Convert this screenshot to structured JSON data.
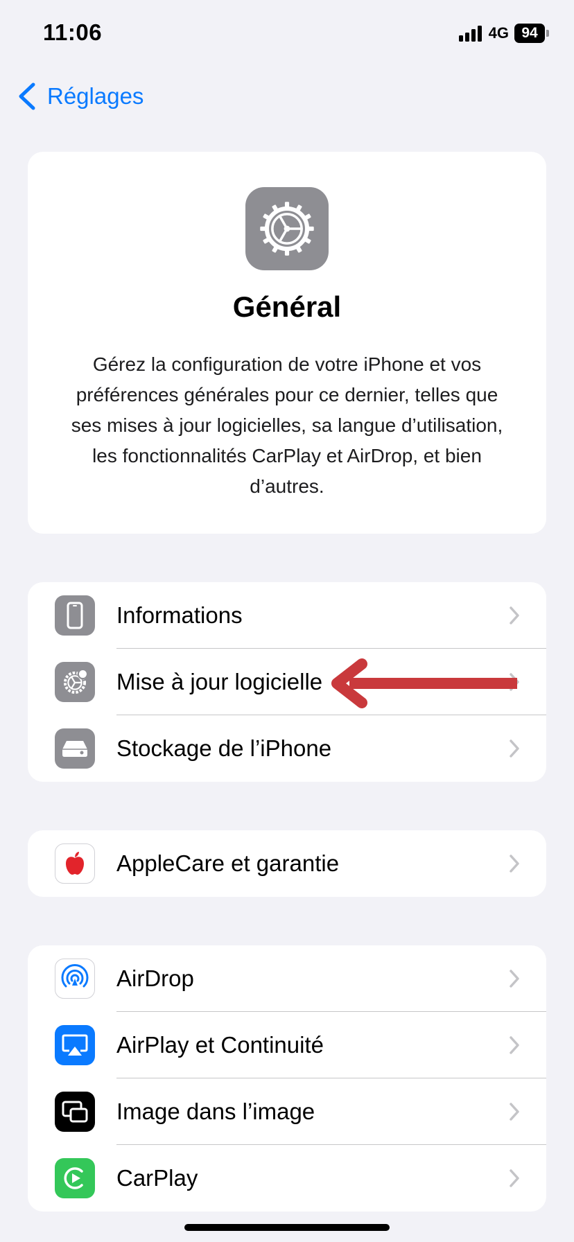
{
  "status_bar": {
    "time": "11:06",
    "network": "4G",
    "battery": "94"
  },
  "nav": {
    "back_label": "Réglages"
  },
  "hero": {
    "icon": "gear-icon",
    "title": "Général",
    "description": "Gérez la configuration de votre iPhone et vos préférences générales pour ce dernier, telles que ses mises à jour logicielles, sa langue d’utilisation, les fonctionnalités CarPlay et AirDrop, et bien d’autres."
  },
  "groups": [
    {
      "items": [
        {
          "label": "Informations",
          "icon": "phone-icon",
          "icon_color": "#8e8e93"
        },
        {
          "label": "Mise à jour logicielle",
          "icon": "gear-badge-icon",
          "icon_color": "#8e8e93"
        },
        {
          "label": "Stockage de l’iPhone",
          "icon": "storage-icon",
          "icon_color": "#8e8e93"
        }
      ]
    },
    {
      "items": [
        {
          "label": "AppleCare et garantie",
          "icon": "apple-icon",
          "icon_color": "#e2242b"
        }
      ]
    },
    {
      "items": [
        {
          "label": "AirDrop",
          "icon": "airdrop-icon",
          "icon_color": "#0a7aff"
        },
        {
          "label": "AirPlay et Continuité",
          "icon": "airplay-icon",
          "icon_color": "#0a7aff"
        },
        {
          "label": "Image dans l’image",
          "icon": "picture-in-picture-icon",
          "icon_color": "#000000"
        },
        {
          "label": "CarPlay",
          "icon": "carplay-icon",
          "icon_color": "#34c759"
        }
      ]
    }
  ],
  "annotation": {
    "type": "arrow",
    "color": "#c9393c",
    "points_to": "Mise à jour logicielle"
  }
}
